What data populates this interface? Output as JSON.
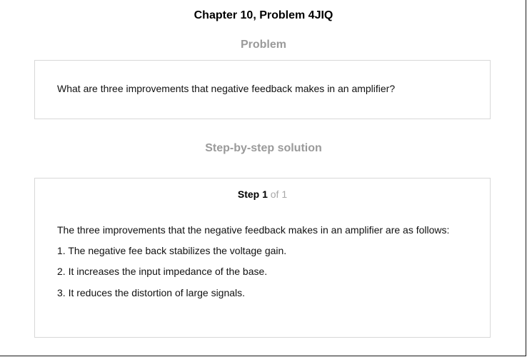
{
  "page": {
    "title": "Chapter 10, Problem 4JIQ"
  },
  "problem": {
    "heading": "Problem",
    "text": "What are three improvements that negative feedback makes in an amplifier?"
  },
  "solution": {
    "heading": "Step-by-step solution",
    "step": {
      "label": "Step 1",
      "of_text": "of 1"
    },
    "lines": [
      "The three improvements that the negative feedback makes in an amplifier are as follows:",
      "1. The negative fee back stabilizes the voltage gain.",
      "2. It increases the input impedance of the base.",
      "3. It reduces the distortion of large signals."
    ]
  }
}
